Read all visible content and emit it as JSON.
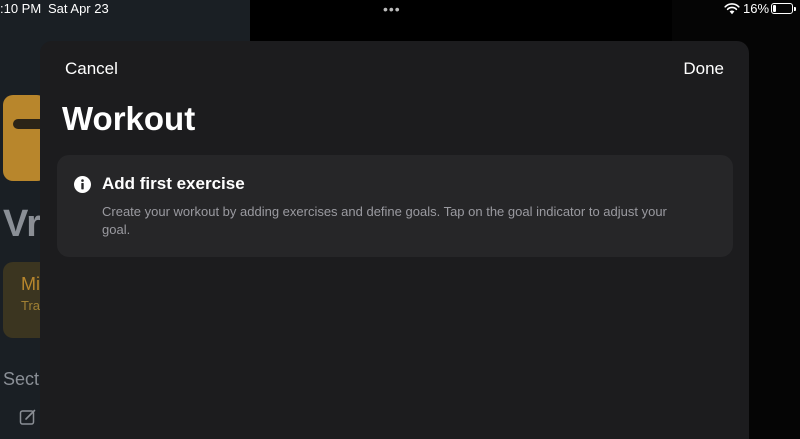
{
  "status_bar": {
    "time": ":10 PM",
    "date": "Sat Apr 23",
    "multitask_dots": "•••",
    "battery_percent": "16%",
    "battery_level": 0.16,
    "icons": [
      "wifi-icon",
      "battery-icon"
    ]
  },
  "background_app": {
    "title_fragment": "Vr",
    "card_title_fragment": "Mi",
    "card_subtitle_fragment": "Tra",
    "section_fragment": "Sect",
    "icons": [
      "app-icon",
      "edit-icon"
    ]
  },
  "sheet": {
    "cancel_label": "Cancel",
    "done_label": "Done",
    "title": "Workout",
    "info_card": {
      "icon": "info-icon",
      "title": "Add first exercise",
      "body": "Create your workout by adding exercises and define goals. Tap on the goal indicator to adjust your goal."
    }
  },
  "colors": {
    "sheet_background": "#1c1c1e",
    "card_background": "#262628",
    "secondary_text": "#9a9aa0",
    "accent_orange": "#b8862c"
  }
}
